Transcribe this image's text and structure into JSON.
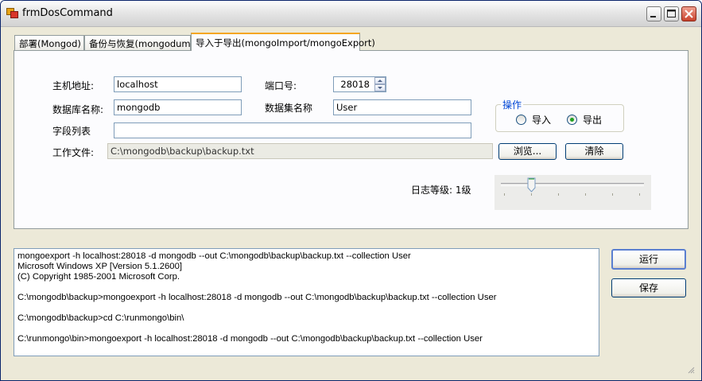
{
  "window": {
    "title": "frmDosCommand"
  },
  "tabs": [
    {
      "label": "部署(Mongod)"
    },
    {
      "label": "备份与恢复(mongodump)"
    },
    {
      "label": "导入于导出(mongoImport/mongoExport)"
    }
  ],
  "form": {
    "host_label": "主机地址:",
    "host_value": "localhost",
    "port_label": "端口号:",
    "port_value": "28018",
    "db_label": "数据库名称:",
    "db_value": "mongodb",
    "collection_label": "数据集名称",
    "collection_value": "User",
    "fields_label": "字段列表",
    "fields_value": "",
    "workfile_label": "工作文件:",
    "workfile_value": "C:\\mongodb\\backup\\backup.txt",
    "browse_label": "浏览...",
    "clear_label": "清除",
    "log_label": "日志等级: 1级",
    "log_level": 1
  },
  "operation": {
    "legend": "操作",
    "import_label": "导入",
    "export_label": "导出",
    "selected": "export"
  },
  "actions": {
    "run_label": "运行",
    "save_label": "保存"
  },
  "output_lines": [
    "mongoexport -h localhost:28018 -d mongodb --out C:\\mongodb\\backup\\backup.txt --collection User",
    "Microsoft Windows XP [Version 5.1.2600]",
    "(C) Copyright 1985-2001 Microsoft Corp.",
    "",
    "C:\\mongodb\\backup>mongoexport -h localhost:28018 -d mongodb --out C:\\mongodb\\backup\\backup.txt --collection User",
    "",
    "C:\\mongodb\\backup>cd C:\\runmongo\\bin\\",
    "",
    "C:\\runmongo\\bin>mongoexport -h localhost:28018 -d mongodb --out C:\\mongodb\\backup\\backup.txt --collection User"
  ],
  "colors": {
    "accent": "#f5a623",
    "legend": "#0046d5",
    "radio_selected": "#21a121"
  }
}
